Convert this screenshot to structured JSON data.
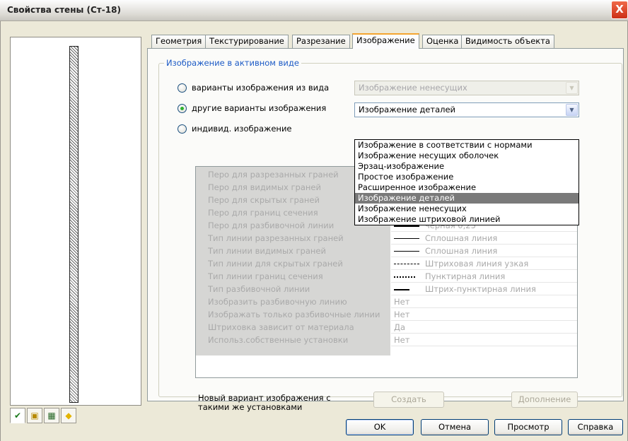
{
  "window": {
    "title": "Свойства стены (Ст-18)",
    "close_glyph": "X"
  },
  "view_tabs": [
    {
      "icon": "plan-view-icon",
      "glyph": "✔"
    },
    {
      "icon": "axonometric-view-icon",
      "glyph": "▣"
    },
    {
      "icon": "section-view-icon",
      "glyph": "▦"
    },
    {
      "icon": "material-view-icon",
      "glyph": "◆"
    }
  ],
  "tabs": [
    {
      "label": "Геометрия",
      "active": false
    },
    {
      "label": "Текстурирование",
      "active": false
    },
    {
      "label": "Разрезание",
      "active": false
    },
    {
      "label": "Изображение",
      "active": true
    },
    {
      "label": "Оценка",
      "active": false
    },
    {
      "label": "Видимость объекта",
      "active": false
    }
  ],
  "group": {
    "title": "Изображение в активном виде",
    "radios": [
      {
        "label": "варианты изображения из вида",
        "checked": false
      },
      {
        "label": "другие варианты изображения",
        "checked": true
      },
      {
        "label": "индивид. изображение",
        "checked": false
      }
    ],
    "combo_from_view": {
      "value": "Изображение ненесущих"
    },
    "combo_other": {
      "value": "Изображение деталей"
    },
    "dropdown_options": [
      "Изображение в соответствии с нормами",
      "Изображение несущих оболочек",
      "Эрзац-изображение",
      "Простое изображение",
      "Расширенное изображение",
      "Изображение деталей",
      "Изображение ненесущих",
      "Изображение штриховой линией"
    ],
    "dropdown_selected_index": 5
  },
  "properties": [
    {
      "name": "Перо для разрезанных граней",
      "value": ""
    },
    {
      "name": "Перо для видимых граней",
      "value": ""
    },
    {
      "name": "Перо для скрытых граней",
      "value": ""
    },
    {
      "name": "Перо для границ сечения",
      "value": ""
    },
    {
      "name": "Перо для разбивочной линии",
      "value": "черная 0,25",
      "line": "thick"
    },
    {
      "name": "Тип линии разрезанных граней",
      "value": "Сплошная линия",
      "line": "solid"
    },
    {
      "name": "Тип линии видимых граней",
      "value": "Сплошная линия",
      "line": "solid"
    },
    {
      "name": "Тип линии для скрытых граней",
      "value": "Штриховая линия узкая",
      "line": "dash"
    },
    {
      "name": "Тип линии границ сечения",
      "value": "Пунктирная линия",
      "line": "dot"
    },
    {
      "name": "Тип разбивочной линии",
      "value": "Штрих-пунктирная линия",
      "line": "dashdot"
    },
    {
      "name": "Изобразить разбивочную линию",
      "value": "Нет"
    },
    {
      "name": "Изображать только разбивочные линии",
      "value": "Нет"
    },
    {
      "name": "Штриховка зависит от материала",
      "value": "Да"
    },
    {
      "name": "Использ.собственные установки",
      "value": "Нет"
    }
  ],
  "new_variant": {
    "label_line1": "Новый вариант изображения с",
    "label_line2": "такими же установками",
    "create_button": "Создать",
    "extra_button": "Дополнение"
  },
  "footer": {
    "ok": "OK",
    "cancel": "Отмена",
    "preview": "Просмотр",
    "help": "Справка"
  }
}
